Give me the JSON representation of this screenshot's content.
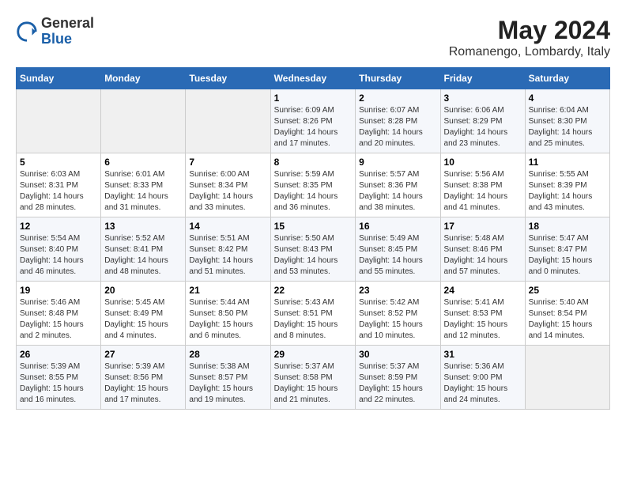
{
  "header": {
    "logo_general": "General",
    "logo_blue": "Blue",
    "month_year": "May 2024",
    "location": "Romanengo, Lombardy, Italy"
  },
  "weekdays": [
    "Sunday",
    "Monday",
    "Tuesday",
    "Wednesday",
    "Thursday",
    "Friday",
    "Saturday"
  ],
  "weeks": [
    [
      {
        "day": "",
        "info": ""
      },
      {
        "day": "",
        "info": ""
      },
      {
        "day": "",
        "info": ""
      },
      {
        "day": "1",
        "info": "Sunrise: 6:09 AM\nSunset: 8:26 PM\nDaylight: 14 hours\nand 17 minutes."
      },
      {
        "day": "2",
        "info": "Sunrise: 6:07 AM\nSunset: 8:28 PM\nDaylight: 14 hours\nand 20 minutes."
      },
      {
        "day": "3",
        "info": "Sunrise: 6:06 AM\nSunset: 8:29 PM\nDaylight: 14 hours\nand 23 minutes."
      },
      {
        "day": "4",
        "info": "Sunrise: 6:04 AM\nSunset: 8:30 PM\nDaylight: 14 hours\nand 25 minutes."
      }
    ],
    [
      {
        "day": "5",
        "info": "Sunrise: 6:03 AM\nSunset: 8:31 PM\nDaylight: 14 hours\nand 28 minutes."
      },
      {
        "day": "6",
        "info": "Sunrise: 6:01 AM\nSunset: 8:33 PM\nDaylight: 14 hours\nand 31 minutes."
      },
      {
        "day": "7",
        "info": "Sunrise: 6:00 AM\nSunset: 8:34 PM\nDaylight: 14 hours\nand 33 minutes."
      },
      {
        "day": "8",
        "info": "Sunrise: 5:59 AM\nSunset: 8:35 PM\nDaylight: 14 hours\nand 36 minutes."
      },
      {
        "day": "9",
        "info": "Sunrise: 5:57 AM\nSunset: 8:36 PM\nDaylight: 14 hours\nand 38 minutes."
      },
      {
        "day": "10",
        "info": "Sunrise: 5:56 AM\nSunset: 8:38 PM\nDaylight: 14 hours\nand 41 minutes."
      },
      {
        "day": "11",
        "info": "Sunrise: 5:55 AM\nSunset: 8:39 PM\nDaylight: 14 hours\nand 43 minutes."
      }
    ],
    [
      {
        "day": "12",
        "info": "Sunrise: 5:54 AM\nSunset: 8:40 PM\nDaylight: 14 hours\nand 46 minutes."
      },
      {
        "day": "13",
        "info": "Sunrise: 5:52 AM\nSunset: 8:41 PM\nDaylight: 14 hours\nand 48 minutes."
      },
      {
        "day": "14",
        "info": "Sunrise: 5:51 AM\nSunset: 8:42 PM\nDaylight: 14 hours\nand 51 minutes."
      },
      {
        "day": "15",
        "info": "Sunrise: 5:50 AM\nSunset: 8:43 PM\nDaylight: 14 hours\nand 53 minutes."
      },
      {
        "day": "16",
        "info": "Sunrise: 5:49 AM\nSunset: 8:45 PM\nDaylight: 14 hours\nand 55 minutes."
      },
      {
        "day": "17",
        "info": "Sunrise: 5:48 AM\nSunset: 8:46 PM\nDaylight: 14 hours\nand 57 minutes."
      },
      {
        "day": "18",
        "info": "Sunrise: 5:47 AM\nSunset: 8:47 PM\nDaylight: 15 hours\nand 0 minutes."
      }
    ],
    [
      {
        "day": "19",
        "info": "Sunrise: 5:46 AM\nSunset: 8:48 PM\nDaylight: 15 hours\nand 2 minutes."
      },
      {
        "day": "20",
        "info": "Sunrise: 5:45 AM\nSunset: 8:49 PM\nDaylight: 15 hours\nand 4 minutes."
      },
      {
        "day": "21",
        "info": "Sunrise: 5:44 AM\nSunset: 8:50 PM\nDaylight: 15 hours\nand 6 minutes."
      },
      {
        "day": "22",
        "info": "Sunrise: 5:43 AM\nSunset: 8:51 PM\nDaylight: 15 hours\nand 8 minutes."
      },
      {
        "day": "23",
        "info": "Sunrise: 5:42 AM\nSunset: 8:52 PM\nDaylight: 15 hours\nand 10 minutes."
      },
      {
        "day": "24",
        "info": "Sunrise: 5:41 AM\nSunset: 8:53 PM\nDaylight: 15 hours\nand 12 minutes."
      },
      {
        "day": "25",
        "info": "Sunrise: 5:40 AM\nSunset: 8:54 PM\nDaylight: 15 hours\nand 14 minutes."
      }
    ],
    [
      {
        "day": "26",
        "info": "Sunrise: 5:39 AM\nSunset: 8:55 PM\nDaylight: 15 hours\nand 16 minutes."
      },
      {
        "day": "27",
        "info": "Sunrise: 5:39 AM\nSunset: 8:56 PM\nDaylight: 15 hours\nand 17 minutes."
      },
      {
        "day": "28",
        "info": "Sunrise: 5:38 AM\nSunset: 8:57 PM\nDaylight: 15 hours\nand 19 minutes."
      },
      {
        "day": "29",
        "info": "Sunrise: 5:37 AM\nSunset: 8:58 PM\nDaylight: 15 hours\nand 21 minutes."
      },
      {
        "day": "30",
        "info": "Sunrise: 5:37 AM\nSunset: 8:59 PM\nDaylight: 15 hours\nand 22 minutes."
      },
      {
        "day": "31",
        "info": "Sunrise: 5:36 AM\nSunset: 9:00 PM\nDaylight: 15 hours\nand 24 minutes."
      },
      {
        "day": "",
        "info": ""
      }
    ]
  ]
}
